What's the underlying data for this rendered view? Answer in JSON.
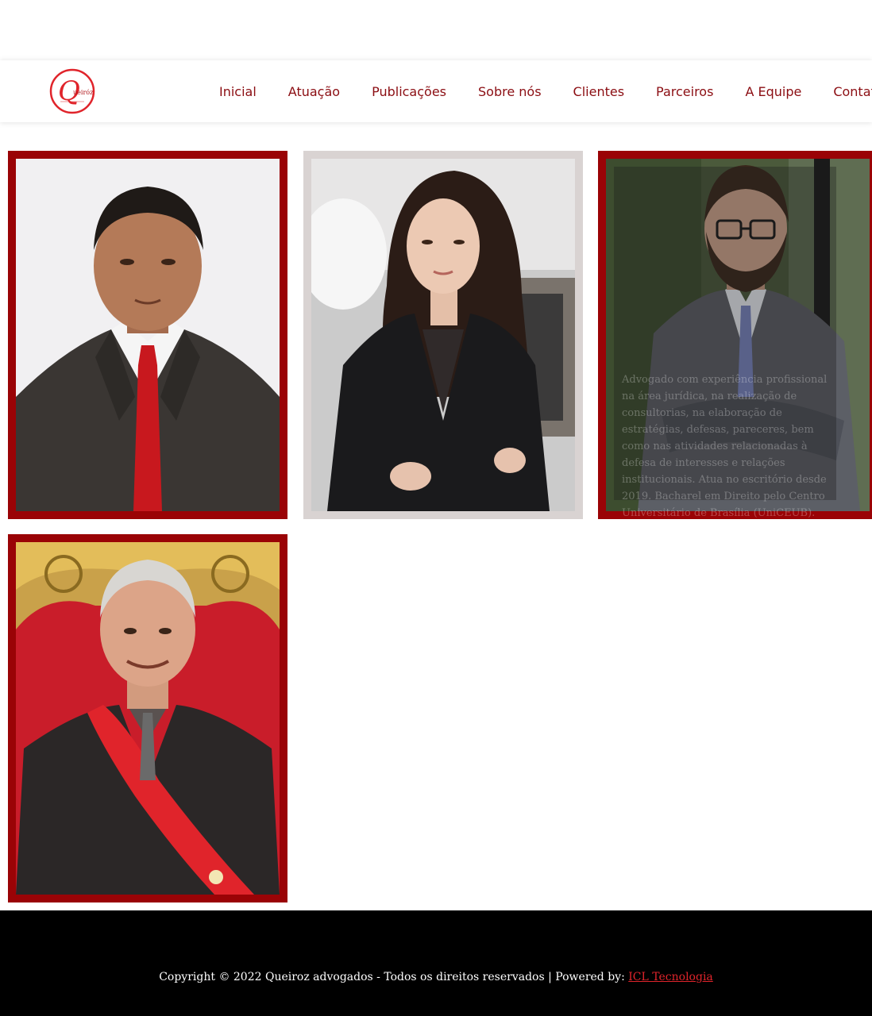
{
  "header": {
    "logo_alt": "Queiróz",
    "menu": [
      {
        "label": "Inicial"
      },
      {
        "label": "Atuação"
      },
      {
        "label": "Publicações"
      },
      {
        "label": "Sobre nós"
      },
      {
        "label": "Clientes"
      },
      {
        "label": "Parceiros"
      },
      {
        "label": "A Equipe"
      },
      {
        "label": "Contato"
      }
    ]
  },
  "team": {
    "hover_bio": "Advogado com experiência profissional na área jurídica, na realização de consultorias, na elaboração de estratégias, defesas, pareceres, bem como nas atividades relacionadas à defesa de interesses e relações institucionais. Atua no escritório desde 2019. Bacharel em Direito pelo Centro Universitário de Brasília (UniCEUB). Pós-graduado em Direito Civil e Direito Processual Civil pela Escola da Magistratura do Distrito Federal."
  },
  "footer": {
    "copyright": "Copyright © 2022 Queiroz advogados - Todos os direitos reservados | Powered by: ",
    "brand": "ICL Tecnologia"
  },
  "colors": {
    "brand_red": "#9a0306",
    "menu_text": "#8b0d12",
    "footer_bg": "#000000",
    "link_red": "#e0242b"
  }
}
